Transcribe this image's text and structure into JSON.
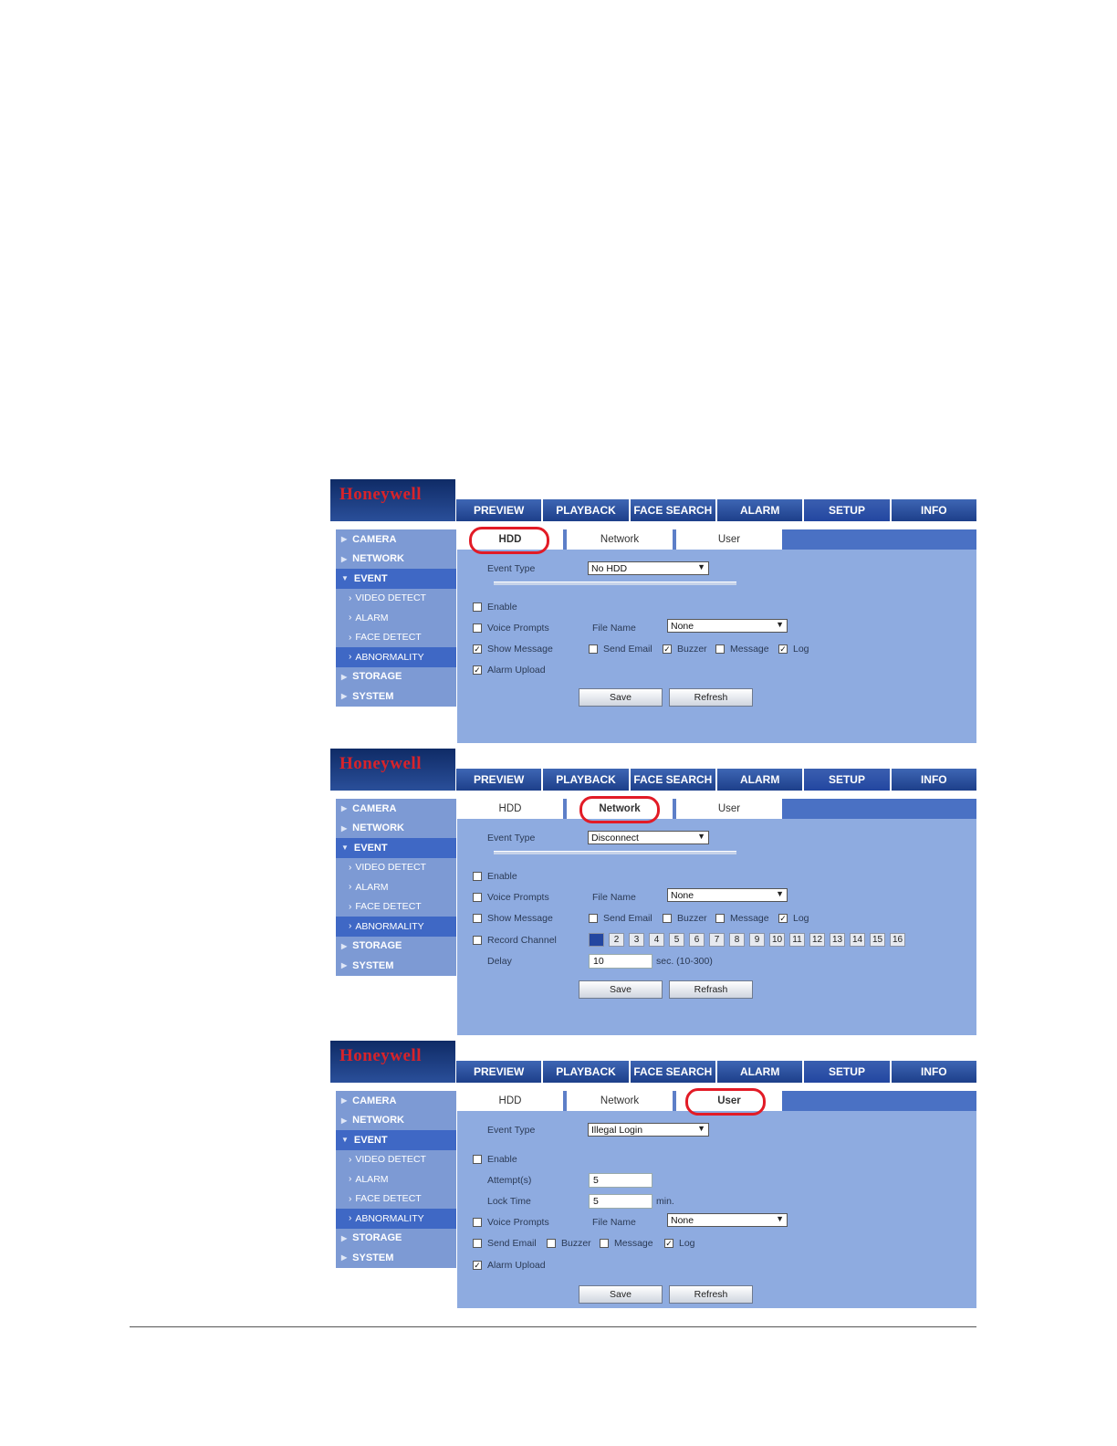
{
  "brand": "Honeywell",
  "nav": [
    "PREVIEW",
    "PLAYBACK",
    "FACE SEARCH",
    "ALARM",
    "SETUP",
    "INFO"
  ],
  "sidebar": {
    "main": [
      "CAMERA",
      "NETWORK",
      "EVENT"
    ],
    "sub": [
      "VIDEO DETECT",
      "ALARM",
      "FACE DETECT",
      "ABNORMALITY"
    ],
    "tail": [
      "STORAGE",
      "SYSTEM"
    ]
  },
  "tabs": [
    "HDD",
    "Network",
    "User"
  ],
  "common": {
    "event_type_label": "Event Type",
    "enable_label": "Enable",
    "voice_prompts_label": "Voice Prompts",
    "file_name_label": "File Name",
    "file_name_value": "None",
    "show_message_label": "Show Message",
    "send_email_label": "Send Email",
    "buzzer_label": "Buzzer",
    "message_label": "Message",
    "log_label": "Log",
    "alarm_upload_label": "Alarm Upload",
    "save_label": "Save",
    "refresh_label": "Refresh",
    "refresh_label_2": "Refrash"
  },
  "panel1": {
    "event_type": "No HDD"
  },
  "panel2": {
    "event_type": "Disconnect",
    "record_channel_label": "Record Channel",
    "channels": [
      "1",
      "2",
      "3",
      "4",
      "5",
      "6",
      "7",
      "8",
      "9",
      "10",
      "11",
      "12",
      "13",
      "14",
      "15",
      "16"
    ],
    "delay_label": "Delay",
    "delay_value": "10",
    "delay_unit": "sec. (10-300)"
  },
  "panel3": {
    "event_type": "Illegal Login",
    "attempts_label": "Attempt(s)",
    "attempts_value": "5",
    "lock_time_label": "Lock Time",
    "lock_time_value": "5",
    "lock_time_unit": "min."
  },
  "colors": {
    "accent_ring": "#e21b26",
    "nav_blue": "#1d3f8a",
    "content_bg": "#8eabe0",
    "brand_red": "#d8232a"
  }
}
